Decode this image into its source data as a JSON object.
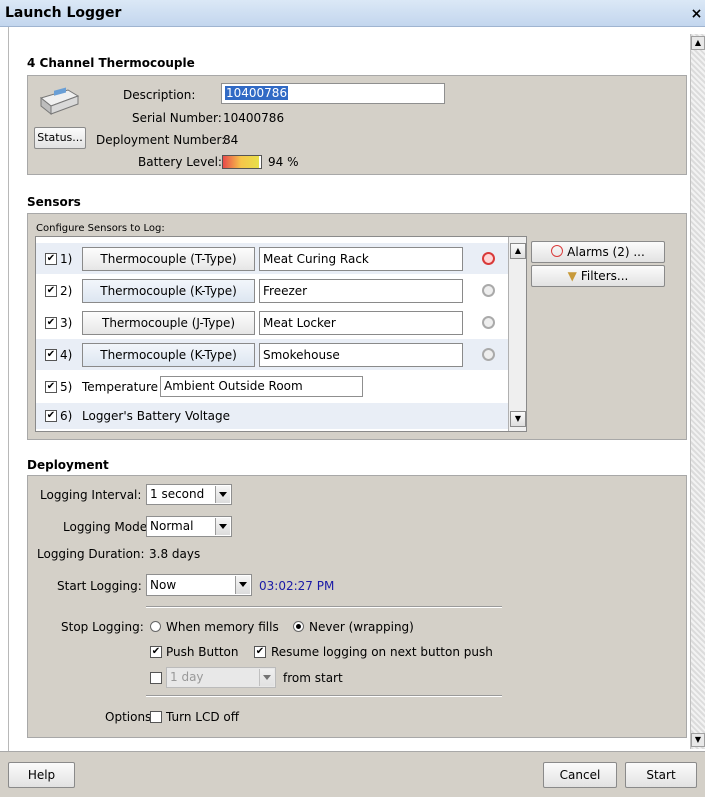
{
  "window": {
    "title": "Launch Logger",
    "close_glyph": "×"
  },
  "device": {
    "heading": "4 Channel Thermocouple",
    "status_label": "Status...",
    "description_label": "Description:",
    "description_value": "10400786",
    "serial_label": "Serial Number:",
    "serial_value": "10400786",
    "deployment_label": "Deployment Number:",
    "deployment_value": "84",
    "battery_label": "Battery Level:",
    "battery_value": "94 %",
    "battery_fraction": 0.94
  },
  "sensors": {
    "heading": "Sensors",
    "configure_label": "Configure Sensors to Log:",
    "rows": [
      {
        "num": "1)",
        "type": "Thermocouple (T-Type)",
        "name": "Meat Curing Rack",
        "checked": true,
        "alarm": true
      },
      {
        "num": "2)",
        "type": "Thermocouple (K-Type)",
        "name": "Freezer",
        "checked": true,
        "alarm": false
      },
      {
        "num": "3)",
        "type": "Thermocouple (J-Type)",
        "name": "Meat Locker",
        "checked": true,
        "alarm": false
      },
      {
        "num": "4)",
        "type": "Thermocouple (K-Type)",
        "name": "Smokehouse",
        "checked": true,
        "alarm": false
      }
    ],
    "row5": {
      "num": "5)",
      "label": "Temperature",
      "value": "Ambient Outside Room",
      "checked": true
    },
    "row6": {
      "num": "6)",
      "label": "Logger's Battery Voltage",
      "checked": true
    },
    "alarms_button": "Alarms (2) ...",
    "filters_button": "Filters..."
  },
  "deployment": {
    "heading": "Deployment",
    "interval_label": "Logging Interval:",
    "interval_value": "1 second",
    "mode_label": "Logging Mode:",
    "mode_value": "Normal",
    "duration_label": "Logging Duration:",
    "duration_value": "3.8 days",
    "start_label": "Start Logging:",
    "start_value": "Now",
    "start_time": "03:02:27 PM",
    "stop_label": "Stop Logging:",
    "stop_option_1": "When memory fills",
    "stop_option_2": "Never (wrapping)",
    "push_button_label": "Push Button",
    "resume_label": "Resume logging on next button push",
    "duration_select": "1 day",
    "from_start_label": "from start",
    "options_label": "Options:",
    "lcd_label": "Turn LCD off"
  },
  "footer": {
    "help": "Help",
    "cancel": "Cancel",
    "start": "Start"
  },
  "colors": {
    "accent_time": "#1a1aa6",
    "panel": "#d4d0c8",
    "selection": "#316ac5",
    "alarm_on": "#d93a3a"
  }
}
